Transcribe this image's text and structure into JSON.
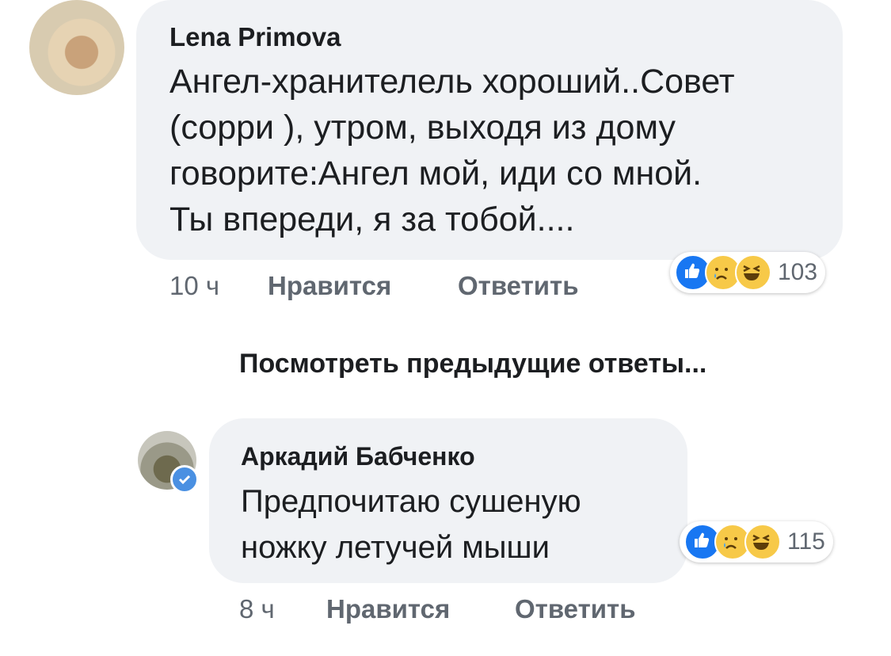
{
  "comments": [
    {
      "author": "Lena Primova",
      "text": "Ангел-хранителель хороший..Совет\n(сорри ), утром, выходя из дому\nговорите:Ангел мой, иди со мной.\nТы впереди, я за тобой....",
      "time": "10 ч",
      "like_label": "Нравится",
      "reply_label": "Ответить",
      "reaction_count": "103",
      "reactions": [
        "like-icon",
        "sad-face-icon",
        "laughing-face-icon"
      ]
    },
    {
      "author": "Аркадий Бабченко",
      "text": "Предпочитаю сушеную\nножку летучей мыши",
      "time": "8 ч",
      "like_label": "Нравится",
      "reply_label": "Ответить",
      "reaction_count": "115",
      "reactions": [
        "like-icon",
        "sad-face-icon",
        "laughing-face-icon"
      ],
      "verified": true
    }
  ],
  "view_previous_replies": "Посмотреть предыдущие ответы...",
  "colors": {
    "bubble": "#f0f2f5",
    "text": "#1c1e21",
    "meta": "#606770",
    "like_blue": "#1877f2",
    "emoji_yellow": "#f7c948"
  }
}
